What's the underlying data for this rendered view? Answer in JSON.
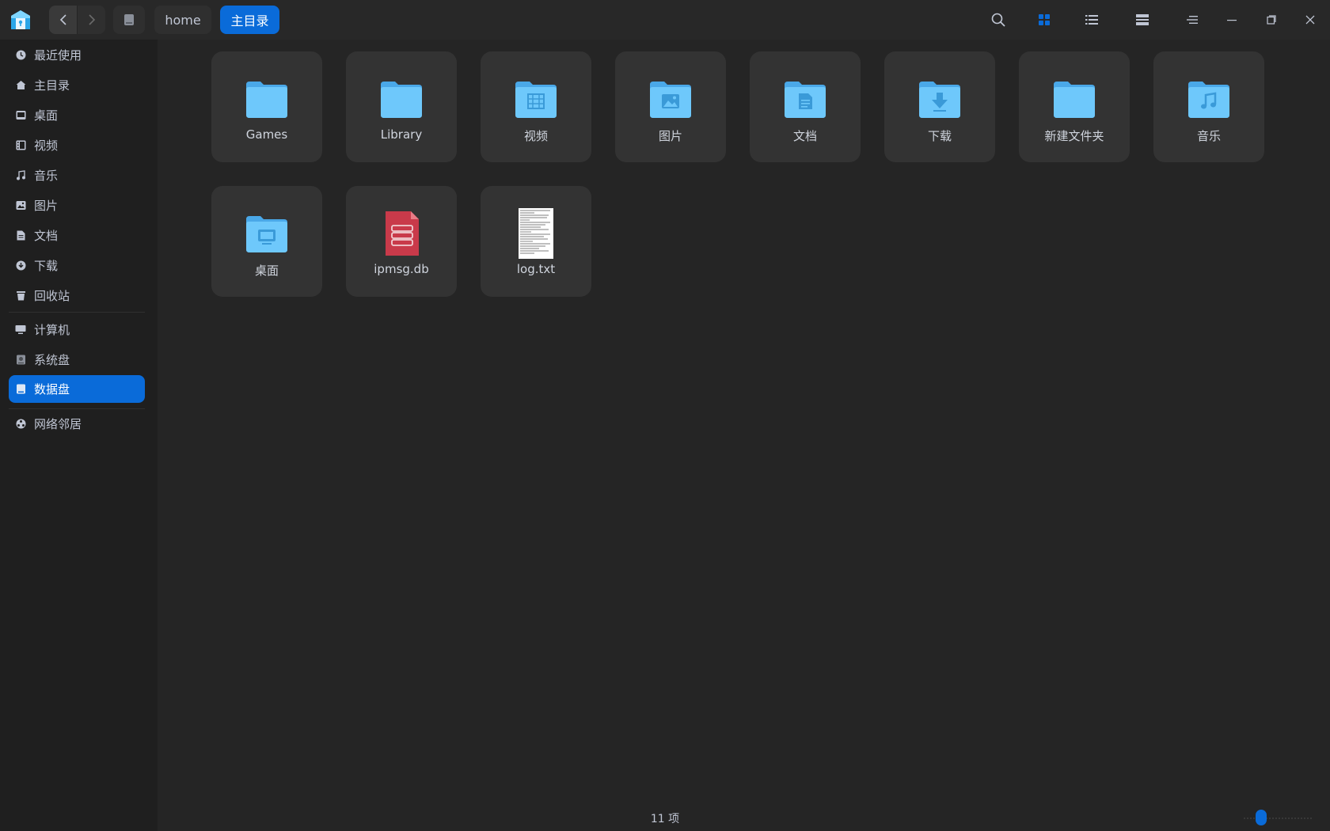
{
  "toolbar": {
    "crumbs": [
      {
        "label": "home"
      },
      {
        "label": "主目录"
      }
    ],
    "icons": [
      "search-icon",
      "icon-view-icon",
      "list-view-icon",
      "details-view-icon",
      "menu-icon",
      "minimize-icon",
      "maximize-icon",
      "close-icon"
    ]
  },
  "sidebar": {
    "items": [
      {
        "label": "最近使用",
        "icon": "clock-icon"
      },
      {
        "label": "主目录",
        "icon": "home-icon"
      },
      {
        "label": "桌面",
        "icon": "desktop-icon"
      },
      {
        "label": "视频",
        "icon": "video-icon"
      },
      {
        "label": "音乐",
        "icon": "music-icon"
      },
      {
        "label": "图片",
        "icon": "picture-icon"
      },
      {
        "label": "文档",
        "icon": "document-icon"
      },
      {
        "label": "下载",
        "icon": "download-icon"
      },
      {
        "label": "回收站",
        "icon": "trash-icon"
      },
      {
        "label": "计算机",
        "icon": "computer-icon"
      },
      {
        "label": "系统盘",
        "icon": "system-disk-icon"
      },
      {
        "label": "数据盘",
        "icon": "data-disk-icon",
        "selected": true
      },
      {
        "label": "网络邻居",
        "icon": "network-icon"
      }
    ]
  },
  "files": [
    {
      "name": "Games",
      "icon": "folder-icon"
    },
    {
      "name": "Library",
      "icon": "folder-icon"
    },
    {
      "name": "视频",
      "icon": "folder-video-icon"
    },
    {
      "name": "图片",
      "icon": "folder-picture-icon"
    },
    {
      "name": "文档",
      "icon": "folder-document-icon"
    },
    {
      "name": "下载",
      "icon": "folder-download-icon"
    },
    {
      "name": "新建文件夹",
      "icon": "folder-icon"
    },
    {
      "name": "音乐",
      "icon": "folder-music-icon"
    },
    {
      "name": "桌面",
      "icon": "folder-desktop-icon"
    },
    {
      "name": "ipmsg.db",
      "icon": "database-file-icon"
    },
    {
      "name": "log.txt",
      "icon": "text-file-icon"
    }
  ],
  "status": {
    "count": "11 项"
  },
  "colors": {
    "accent": "#0a6bd9",
    "folder": "#6ec8fb",
    "db_file": "#c93a4a"
  }
}
